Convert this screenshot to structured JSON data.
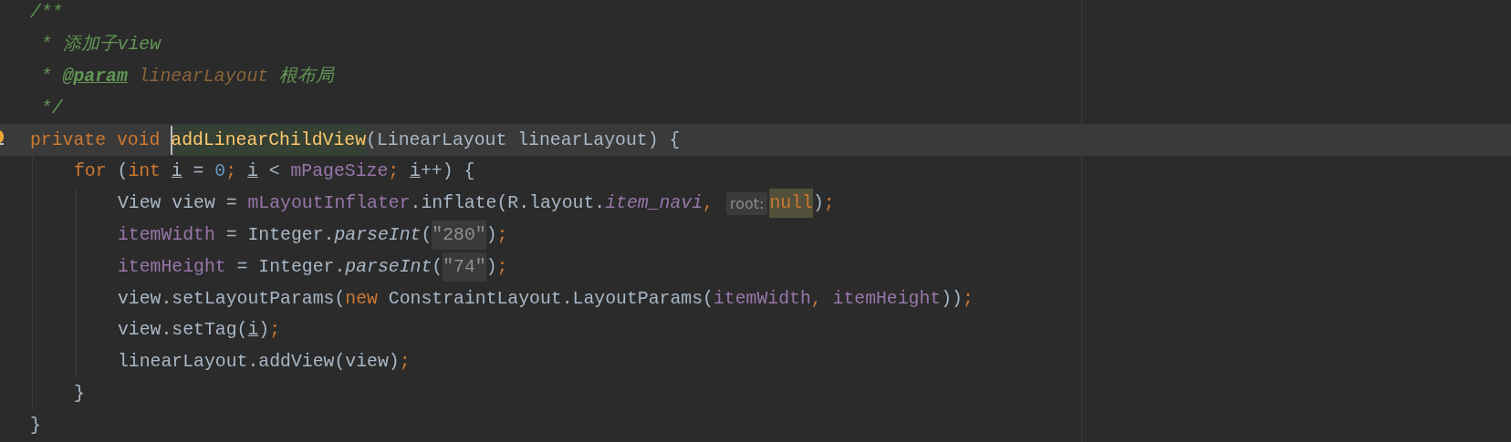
{
  "editor": {
    "lines": [
      {
        "current": false,
        "bulb": false,
        "tokens": [
          {
            "t": "/**",
            "kind": "comment"
          }
        ]
      },
      {
        "current": false,
        "bulb": false,
        "tokens": [
          {
            "t": " * 添加子view",
            "kind": "comment"
          }
        ]
      },
      {
        "current": false,
        "bulb": false,
        "tokens": [
          {
            "t": " * ",
            "kind": "comment"
          },
          {
            "t": "@param",
            "kind": "tag"
          },
          {
            "t": " linearLayout",
            "kind": "pname"
          },
          {
            "t": " 根布局",
            "kind": "comment"
          }
        ]
      },
      {
        "current": false,
        "bulb": false,
        "tokens": [
          {
            "t": " */",
            "kind": "comment"
          }
        ]
      },
      {
        "current": true,
        "bulb": true,
        "tokens": [
          {
            "t": "private void ",
            "kind": "kw"
          },
          {
            "t": "addLinearChildView",
            "kind": "decl-caret"
          },
          {
            "t": "(LinearLayout linearLayout) {",
            "kind": "plain"
          }
        ],
        "children": [
          {
            "current": false,
            "bulb": false,
            "tokens": [
              {
                "t": "for",
                "kind": "kw"
              },
              {
                "t": " (",
                "kind": "plain"
              },
              {
                "t": "int ",
                "kind": "kw"
              },
              {
                "t": "i",
                "kind": "var"
              },
              {
                "t": " = ",
                "kind": "plain"
              },
              {
                "t": "0",
                "kind": "num"
              },
              {
                "t": "; ",
                "kind": "kw"
              },
              {
                "t": "i",
                "kind": "var"
              },
              {
                "t": " < ",
                "kind": "plain"
              },
              {
                "t": "mPageSize",
                "kind": "field"
              },
              {
                "t": "; ",
                "kind": "kw"
              },
              {
                "t": "i",
                "kind": "var"
              },
              {
                "t": "++) {",
                "kind": "plain"
              }
            ],
            "children": [
              {
                "current": false,
                "bulb": false,
                "tokens": [
                  {
                    "t": "View view = ",
                    "kind": "plain"
                  },
                  {
                    "t": "mLayoutInflater",
                    "kind": "field"
                  },
                  {
                    "t": ".inflate(R.layout.",
                    "kind": "plain"
                  },
                  {
                    "t": "item_navi",
                    "kind": "static"
                  },
                  {
                    "t": ",",
                    "kind": "kw"
                  },
                  {
                    "t": "root:",
                    "kind": "hint"
                  },
                  {
                    "t": "null",
                    "kind": "null-hl"
                  },
                  {
                    "t": ")",
                    "kind": "plain"
                  },
                  {
                    "t": ";",
                    "kind": "kw"
                  }
                ]
              },
              {
                "current": false,
                "bulb": false,
                "tokens": [
                  {
                    "t": "itemWidth",
                    "kind": "field"
                  },
                  {
                    "t": " = Integer.",
                    "kind": "plain"
                  },
                  {
                    "t": "parseInt",
                    "kind": "italic"
                  },
                  {
                    "t": "(",
                    "kind": "plain"
                  },
                  {
                    "t": "\"280\"",
                    "kind": "str"
                  },
                  {
                    "t": ")",
                    "kind": "plain"
                  },
                  {
                    "t": ";",
                    "kind": "kw"
                  }
                ]
              },
              {
                "current": false,
                "bulb": false,
                "tokens": [
                  {
                    "t": "itemHeight",
                    "kind": "field"
                  },
                  {
                    "t": " = Integer.",
                    "kind": "plain"
                  },
                  {
                    "t": "parseInt",
                    "kind": "italic"
                  },
                  {
                    "t": "(",
                    "kind": "plain"
                  },
                  {
                    "t": "\"74\"",
                    "kind": "str"
                  },
                  {
                    "t": ")",
                    "kind": "plain"
                  },
                  {
                    "t": ";",
                    "kind": "kw"
                  }
                ]
              },
              {
                "current": false,
                "bulb": false,
                "tokens": [
                  {
                    "t": "view.setLayoutParams(",
                    "kind": "plain"
                  },
                  {
                    "t": "new",
                    "kind": "kw"
                  },
                  {
                    "t": " ConstraintLayout.LayoutParams(",
                    "kind": "plain"
                  },
                  {
                    "t": "itemWidth",
                    "kind": "field"
                  },
                  {
                    "t": ", ",
                    "kind": "kw"
                  },
                  {
                    "t": "itemHeight",
                    "kind": "field"
                  },
                  {
                    "t": "))",
                    "kind": "plain"
                  },
                  {
                    "t": ";",
                    "kind": "kw"
                  }
                ]
              },
              {
                "current": false,
                "bulb": false,
                "tokens": [
                  {
                    "t": "view.setTag(",
                    "kind": "plain"
                  },
                  {
                    "t": "i",
                    "kind": "var"
                  },
                  {
                    "t": ")",
                    "kind": "plain"
                  },
                  {
                    "t": ";",
                    "kind": "kw"
                  }
                ]
              },
              {
                "current": false,
                "bulb": false,
                "tokens": [
                  {
                    "t": "linearLayout.addView(view)",
                    "kind": "plain"
                  },
                  {
                    "t": ";",
                    "kind": "kw"
                  }
                ]
              }
            ]
          },
          {
            "current": false,
            "bulb": false,
            "tokens": [
              {
                "t": "}",
                "kind": "plain"
              }
            ]
          }
        ]
      },
      {
        "current": false,
        "bulb": false,
        "tokens": [
          {
            "t": "}",
            "kind": "plain"
          }
        ]
      }
    ]
  }
}
